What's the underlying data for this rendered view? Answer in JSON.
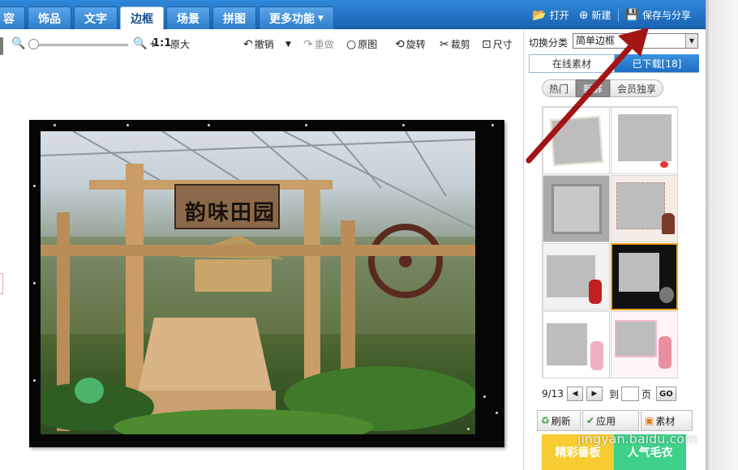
{
  "tabs": [
    {
      "label": "容",
      "active": false
    },
    {
      "label": "饰品",
      "active": false
    },
    {
      "label": "文字",
      "active": false
    },
    {
      "label": "边框",
      "active": true
    },
    {
      "label": "场景",
      "active": false
    },
    {
      "label": "拼图",
      "active": false
    },
    {
      "label": "更多功能",
      "active": false
    }
  ],
  "top_actions": {
    "open": "打开",
    "new": "新建",
    "save_share": "保存与分享"
  },
  "toolbar": {
    "zoom_ratio": "1:1",
    "original_size": "原大",
    "undo": "撤销",
    "redo": "重做",
    "original": "原图",
    "rotate": "旋转",
    "crop": "裁剪",
    "size": "尺寸"
  },
  "photo": {
    "sign_text": "韵味田园"
  },
  "panel": {
    "category_label": "切换分类",
    "category_value": "简单边框",
    "tab_online": "在线素材",
    "tab_downloaded": "已下载[18]",
    "seg_hot": "热门",
    "seg_new": "新鲜",
    "seg_vip": "会员独享",
    "pager_current": "9/13",
    "pager_to": "到",
    "pager_page": "页",
    "pager_go": "GO",
    "btn_refresh": "刷新",
    "btn_apply": "应用",
    "btn_material": "素材"
  },
  "promo": {
    "left": "精彩番板",
    "right": "人气毛衣"
  },
  "watermark": "jingyan.baidu.com",
  "colors": {
    "tab_bar": "#1a63b4",
    "arrow": "#a31515",
    "selected_thumb_border": "#f0a020"
  }
}
